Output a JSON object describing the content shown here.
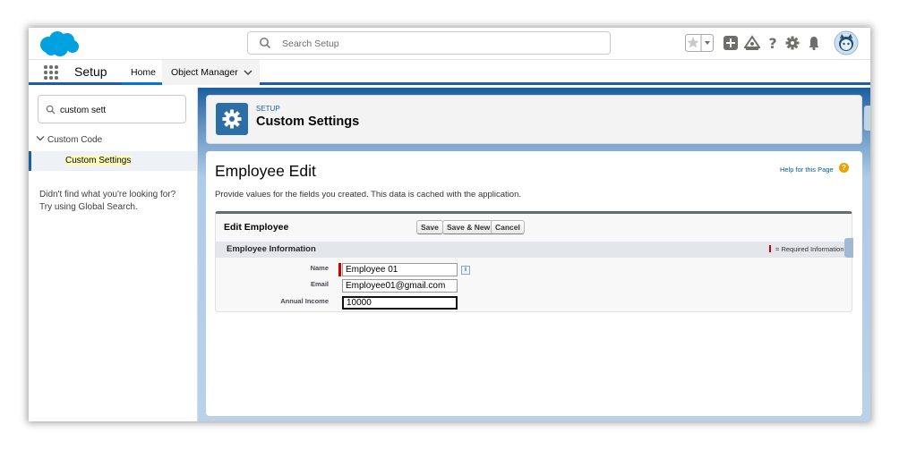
{
  "header": {
    "search_placeholder": "Search Setup"
  },
  "nav": {
    "app_name": "Setup",
    "tabs": [
      {
        "label": "Home"
      },
      {
        "label": "Object Manager"
      }
    ]
  },
  "sidebar": {
    "quick_find_value": "custom sett",
    "tree_parent": "Custom Code",
    "tree_child": "Custom Settings",
    "hint_line1": "Didn't find what you're looking for?",
    "hint_line2": "Try using Global Search."
  },
  "page_header": {
    "eyebrow": "SETUP",
    "title": "Custom Settings"
  },
  "form": {
    "heading": "Employee Edit",
    "help_link": "Help for this Page",
    "description": "Provide values for the fields you created. This data is cached with the application.",
    "block_title": "Edit Employee",
    "buttons": {
      "save": "Save",
      "save_new": "Save & New",
      "cancel": "Cancel"
    },
    "section_title": "Employee Information",
    "required_legend": "= Required Information",
    "fields": {
      "name_label": "Name",
      "name_value": "Employee 01",
      "email_label": "Email",
      "email_value": "Employee01@gmail.com",
      "income_label": "Annual Income",
      "income_value": "10000"
    }
  },
  "colors": {
    "brand_blue": "#1b5f9e",
    "salesforce_cloud": "#00a1e0",
    "required_red": "#c00000",
    "help_orange": "#e8a202"
  },
  "icons": [
    "salesforce-logo",
    "search-icon",
    "favorites-star-icon",
    "favorites-dropdown-icon",
    "global-actions-icon",
    "trailhead-icon",
    "help-icon",
    "gear-icon",
    "notifications-bell-icon",
    "user-avatar",
    "app-launcher-icon",
    "chevron-down-icon",
    "info-icon"
  ]
}
